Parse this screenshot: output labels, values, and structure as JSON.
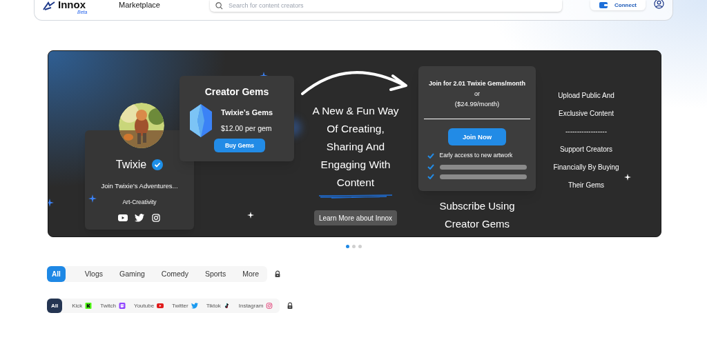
{
  "header": {
    "logo": "Innox",
    "logo_badge": "Beta",
    "nav": "Marketplace",
    "search": {
      "placeholder": "Search for content creators"
    },
    "connect_button": "Connect"
  },
  "banner": {
    "profile": {
      "name": "Twixie",
      "verified": true,
      "tagline": "Join Twixie’s Adventures...",
      "category": "Art-Creativity",
      "socials": [
        {
          "kind": "youtube"
        },
        {
          "kind": "twitter"
        },
        {
          "kind": "instagram"
        }
      ]
    },
    "gems_card": {
      "title": "Creator Gems",
      "gem_name": "Twixie’s Gems",
      "price": "$12.00 per gem",
      "button": "Buy Gems"
    },
    "headline": [
      "A New & Fun Way",
      "Of Creating,",
      "Sharing And",
      "Engaging With",
      "Content"
    ],
    "learn_more": "Learn More about Innox",
    "subscribe_card": {
      "offer": "Join for 2.01 Twixie Gems/month",
      "or": "or",
      "alt_price": "($24.99/month)",
      "button": "Join Now",
      "perks": [
        {
          "kind": "text",
          "text": "Early access to new artwork"
        },
        {
          "kind": "placeholder"
        },
        {
          "kind": "placeholder"
        }
      ]
    },
    "subscribe_caption": [
      "Subscribe Using",
      "Creator Gems"
    ],
    "right_text": [
      "Upload Public And",
      "Exclusive Content",
      "------------------",
      "Support Creators",
      "Financially By Buying",
      "Their Gems"
    ]
  },
  "carousel_dots": [
    {
      "selected": true
    },
    {
      "selected": false
    },
    {
      "selected": false
    }
  ],
  "categories": [
    {
      "label": "All",
      "selected": true
    },
    {
      "label": "Vlogs",
      "selected": false
    },
    {
      "label": "Gaming",
      "selected": false
    },
    {
      "label": "Comedy",
      "selected": false
    },
    {
      "label": "Sports",
      "selected": false
    },
    {
      "label": "More",
      "selected": false
    }
  ],
  "platforms": [
    {
      "label": "All",
      "kind": "all",
      "selected": true
    },
    {
      "label": "Kick",
      "kind": "kick",
      "selected": false
    },
    {
      "label": "Twitch",
      "kind": "twitch",
      "selected": false
    },
    {
      "label": "Youtube",
      "kind": "youtube",
      "selected": false
    },
    {
      "label": "Twitter",
      "kind": "twitter",
      "selected": false
    },
    {
      "label": "Tiktok",
      "kind": "tiktok",
      "selected": false
    },
    {
      "label": "Instagram",
      "kind": "instagram",
      "selected": false
    }
  ]
}
